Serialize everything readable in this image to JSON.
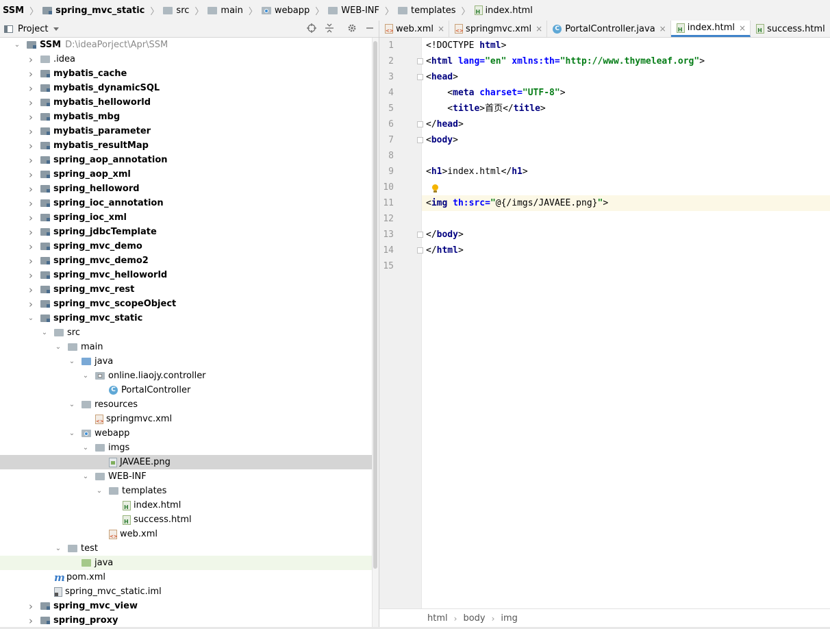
{
  "breadcrumb": [
    "SSM",
    "spring_mvc_static",
    "src",
    "main",
    "webapp",
    "WEB-INF",
    "templates",
    "index.html"
  ],
  "project_panel": {
    "title": "Project",
    "tools": [
      "locate-icon",
      "collapse-all-icon",
      "gear-icon",
      "minimize-icon"
    ]
  },
  "tree": [
    {
      "label": "SSM",
      "path": "D:\\ideaPorject\\Apr\\SSM",
      "depth": 0,
      "expanded": true,
      "icon": "module",
      "bold": true
    },
    {
      "label": ".idea",
      "depth": 1,
      "expanded": false,
      "icon": "folder",
      "bold": false
    },
    {
      "label": "mybatis_cache",
      "depth": 1,
      "expanded": false,
      "icon": "module",
      "bold": true
    },
    {
      "label": "mybatis_dynamicSQL",
      "depth": 1,
      "expanded": false,
      "icon": "module",
      "bold": true
    },
    {
      "label": "mybatis_helloworld",
      "depth": 1,
      "expanded": false,
      "icon": "module",
      "bold": true
    },
    {
      "label": "mybatis_mbg",
      "depth": 1,
      "expanded": false,
      "icon": "module",
      "bold": true
    },
    {
      "label": "mybatis_parameter",
      "depth": 1,
      "expanded": false,
      "icon": "module",
      "bold": true
    },
    {
      "label": "mybatis_resultMap",
      "depth": 1,
      "expanded": false,
      "icon": "module",
      "bold": true
    },
    {
      "label": "spring_aop_annotation",
      "depth": 1,
      "expanded": false,
      "icon": "module",
      "bold": true
    },
    {
      "label": "spring_aop_xml",
      "depth": 1,
      "expanded": false,
      "icon": "module",
      "bold": true
    },
    {
      "label": "spring_helloword",
      "depth": 1,
      "expanded": false,
      "icon": "module",
      "bold": true
    },
    {
      "label": "spring_ioc_annotation",
      "depth": 1,
      "expanded": false,
      "icon": "module",
      "bold": true
    },
    {
      "label": "spring_ioc_xml",
      "depth": 1,
      "expanded": false,
      "icon": "module",
      "bold": true
    },
    {
      "label": "spring_jdbcTemplate",
      "depth": 1,
      "expanded": false,
      "icon": "module",
      "bold": true
    },
    {
      "label": "spring_mvc_demo",
      "depth": 1,
      "expanded": false,
      "icon": "module",
      "bold": true
    },
    {
      "label": "spring_mvc_demo2",
      "depth": 1,
      "expanded": false,
      "icon": "module",
      "bold": true
    },
    {
      "label": "spring_mvc_helloworld",
      "depth": 1,
      "expanded": false,
      "icon": "module",
      "bold": true
    },
    {
      "label": "spring_mvc_rest",
      "depth": 1,
      "expanded": false,
      "icon": "module",
      "bold": true
    },
    {
      "label": "spring_mvc_scopeObject",
      "depth": 1,
      "expanded": false,
      "icon": "module",
      "bold": true
    },
    {
      "label": "spring_mvc_static",
      "depth": 1,
      "expanded": true,
      "icon": "module",
      "bold": true
    },
    {
      "label": "src",
      "depth": 2,
      "expanded": true,
      "icon": "folder",
      "bold": false
    },
    {
      "label": "main",
      "depth": 3,
      "expanded": true,
      "icon": "folder",
      "bold": false
    },
    {
      "label": "java",
      "depth": 4,
      "expanded": true,
      "icon": "folder-blue",
      "bold": false
    },
    {
      "label": "online.liaojy.controller",
      "depth": 5,
      "expanded": true,
      "icon": "package",
      "bold": false
    },
    {
      "label": "PortalController",
      "depth": 6,
      "expanded": null,
      "icon": "class",
      "bold": false
    },
    {
      "label": "resources",
      "depth": 4,
      "expanded": true,
      "icon": "folder-resources",
      "bold": false
    },
    {
      "label": "springmvc.xml",
      "depth": 5,
      "expanded": null,
      "icon": "xml",
      "bold": false
    },
    {
      "label": "webapp",
      "depth": 4,
      "expanded": true,
      "icon": "folder-web",
      "bold": false
    },
    {
      "label": "imgs",
      "depth": 5,
      "expanded": true,
      "icon": "folder",
      "bold": false
    },
    {
      "label": "JAVAEE.png",
      "depth": 6,
      "expanded": null,
      "icon": "image",
      "bold": false,
      "selected": true
    },
    {
      "label": "WEB-INF",
      "depth": 5,
      "expanded": true,
      "icon": "folder",
      "bold": false
    },
    {
      "label": "templates",
      "depth": 6,
      "expanded": true,
      "icon": "folder",
      "bold": false
    },
    {
      "label": "index.html",
      "depth": 7,
      "expanded": null,
      "icon": "html",
      "bold": false
    },
    {
      "label": "success.html",
      "depth": 7,
      "expanded": null,
      "icon": "html",
      "bold": false
    },
    {
      "label": "web.xml",
      "depth": 6,
      "expanded": null,
      "icon": "xml",
      "bold": false
    },
    {
      "label": "test",
      "depth": 3,
      "expanded": true,
      "icon": "folder",
      "bold": false
    },
    {
      "label": "java",
      "depth": 4,
      "expanded": null,
      "icon": "folder-green",
      "bold": false,
      "highlight": true
    },
    {
      "label": "pom.xml",
      "depth": 2,
      "expanded": null,
      "icon": "maven",
      "bold": false
    },
    {
      "label": "spring_mvc_static.iml",
      "depth": 2,
      "expanded": null,
      "icon": "iml",
      "bold": false
    },
    {
      "label": "spring_mvc_view",
      "depth": 1,
      "expanded": false,
      "icon": "module",
      "bold": true
    },
    {
      "label": "spring_proxy",
      "depth": 1,
      "expanded": false,
      "icon": "module",
      "bold": true
    }
  ],
  "tabs": [
    {
      "label": "web.xml",
      "icon": "xml",
      "active": false
    },
    {
      "label": "springmvc.xml",
      "icon": "xml",
      "active": false
    },
    {
      "label": "PortalController.java",
      "icon": "class",
      "active": false
    },
    {
      "label": "index.html",
      "icon": "html",
      "active": true
    },
    {
      "label": "success.html",
      "icon": "html",
      "active": false
    }
  ],
  "editor": {
    "current_line": 11,
    "lines": [
      [
        {
          "t": "<!DOCTYPE ",
          "c": ""
        },
        {
          "t": "html",
          "c": "tagname"
        },
        {
          "t": ">",
          "c": ""
        }
      ],
      [
        {
          "t": "<",
          "c": ""
        },
        {
          "t": "html ",
          "c": "tagname"
        },
        {
          "t": "lang=",
          "c": "attr"
        },
        {
          "t": "\"en\" ",
          "c": "val"
        },
        {
          "t": "xmlns:th=",
          "c": "attr"
        },
        {
          "t": "\"http://www.thymeleaf.org\"",
          "c": "val"
        },
        {
          "t": ">",
          "c": ""
        }
      ],
      [
        {
          "t": "<",
          "c": ""
        },
        {
          "t": "head",
          "c": "tagname"
        },
        {
          "t": ">",
          "c": ""
        }
      ],
      [
        {
          "t": "    <",
          "c": ""
        },
        {
          "t": "meta ",
          "c": "tagname"
        },
        {
          "t": "charset=",
          "c": "attr"
        },
        {
          "t": "\"UTF-8\"",
          "c": "val"
        },
        {
          "t": ">",
          "c": ""
        }
      ],
      [
        {
          "t": "    <",
          "c": ""
        },
        {
          "t": "title",
          "c": "tagname"
        },
        {
          "t": ">首页</",
          "c": ""
        },
        {
          "t": "title",
          "c": "tagname"
        },
        {
          "t": ">",
          "c": ""
        }
      ],
      [
        {
          "t": "</",
          "c": ""
        },
        {
          "t": "head",
          "c": "tagname"
        },
        {
          "t": ">",
          "c": ""
        }
      ],
      [
        {
          "t": "<",
          "c": ""
        },
        {
          "t": "body",
          "c": "tagname"
        },
        {
          "t": ">",
          "c": ""
        }
      ],
      [],
      [
        {
          "t": "<",
          "c": ""
        },
        {
          "t": "h1",
          "c": "tagname"
        },
        {
          "t": ">index.html</",
          "c": ""
        },
        {
          "t": "h1",
          "c": "tagname"
        },
        {
          "t": ">",
          "c": ""
        }
      ],
      [],
      [
        {
          "t": "<",
          "c": ""
        },
        {
          "t": "img ",
          "c": "tagname"
        },
        {
          "t": "th:src=",
          "c": "attr"
        },
        {
          "t": "\"",
          "c": "val"
        },
        {
          "t": "@{/imgs/JAVAEE.png}",
          "c": ""
        },
        {
          "t": "\"",
          "c": "val"
        },
        {
          "t": ">",
          "c": ""
        }
      ],
      [],
      [
        {
          "t": "</",
          "c": ""
        },
        {
          "t": "body",
          "c": "tagname"
        },
        {
          "t": ">",
          "c": ""
        }
      ],
      [
        {
          "t": "</",
          "c": ""
        },
        {
          "t": "html",
          "c": "tagname"
        },
        {
          "t": ">",
          "c": ""
        }
      ],
      []
    ],
    "fold_lines": [
      2,
      3,
      6,
      7,
      13,
      14
    ]
  },
  "status_breadcrumb": [
    "html",
    "body",
    "img"
  ]
}
